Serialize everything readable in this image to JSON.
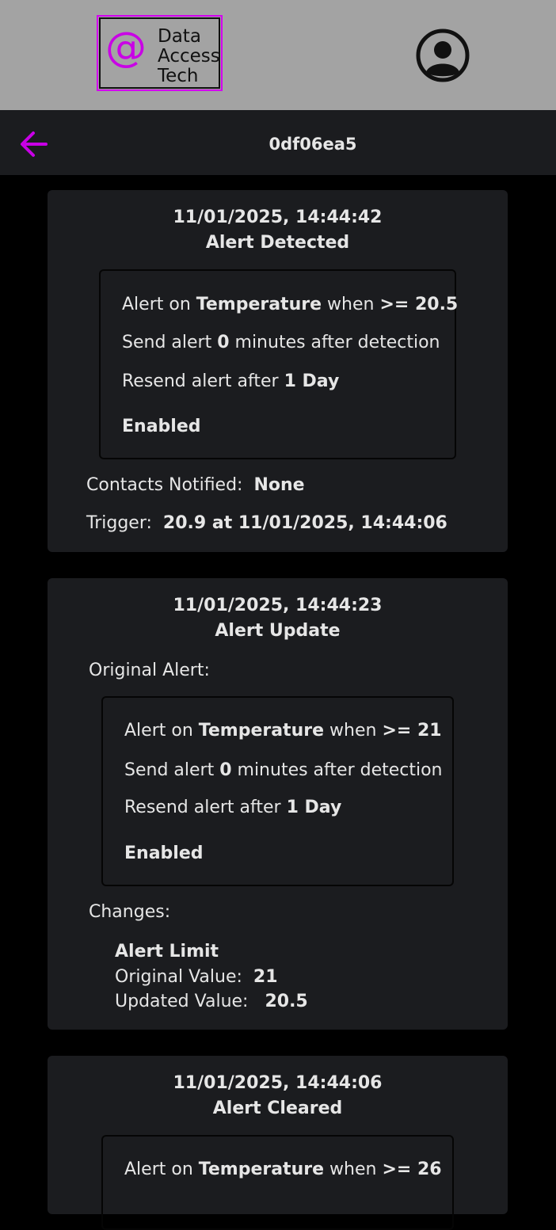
{
  "brand": {
    "logo_symbol": "@",
    "logo_line1": "Data",
    "logo_line2": "Access",
    "logo_line3": "Tech",
    "accent": "#c900e6"
  },
  "header": {
    "profile_icon": "user-circle-icon"
  },
  "subheader": {
    "back_icon": "arrow-left-icon",
    "title": "0df06ea5"
  },
  "events": [
    {
      "timestamp": "11/01/2025, 14:44:42",
      "type": "Alert Detected",
      "rule": {
        "alert_on_prefix": "Alert on",
        "metric": "Temperature",
        "when_word": "when",
        "condition": ">= 20.5",
        "send_prefix": "Send alert",
        "send_minutes": "0",
        "send_suffix": "minutes after detection",
        "resend_prefix": "Resend alert after",
        "resend_value": "1 Day",
        "status": "Enabled"
      },
      "contacts_label": "Contacts Notified:",
      "contacts_value": "None",
      "trigger_label": "Trigger:",
      "trigger_value": "20.9 at 11/01/2025, 14:44:06"
    },
    {
      "timestamp": "11/01/2025, 14:44:23",
      "type": "Alert Update",
      "original_label": "Original Alert:",
      "rule": {
        "alert_on_prefix": "Alert on",
        "metric": "Temperature",
        "when_word": "when",
        "condition": ">= 21",
        "send_prefix": "Send alert",
        "send_minutes": "0",
        "send_suffix": "minutes after detection",
        "resend_prefix": "Resend alert after",
        "resend_value": "1 Day",
        "status": "Enabled"
      },
      "changes_label": "Changes:",
      "change_field": "Alert Limit",
      "original_value_label": "Original Value:",
      "original_value": "21",
      "updated_value_label": "Updated Value:",
      "updated_value": "20.5"
    },
    {
      "timestamp": "11/01/2025, 14:44:06",
      "type": "Alert Cleared",
      "rule": {
        "alert_on_prefix": "Alert on",
        "metric": "Temperature",
        "when_word": "when",
        "condition": ">= 26"
      }
    }
  ]
}
